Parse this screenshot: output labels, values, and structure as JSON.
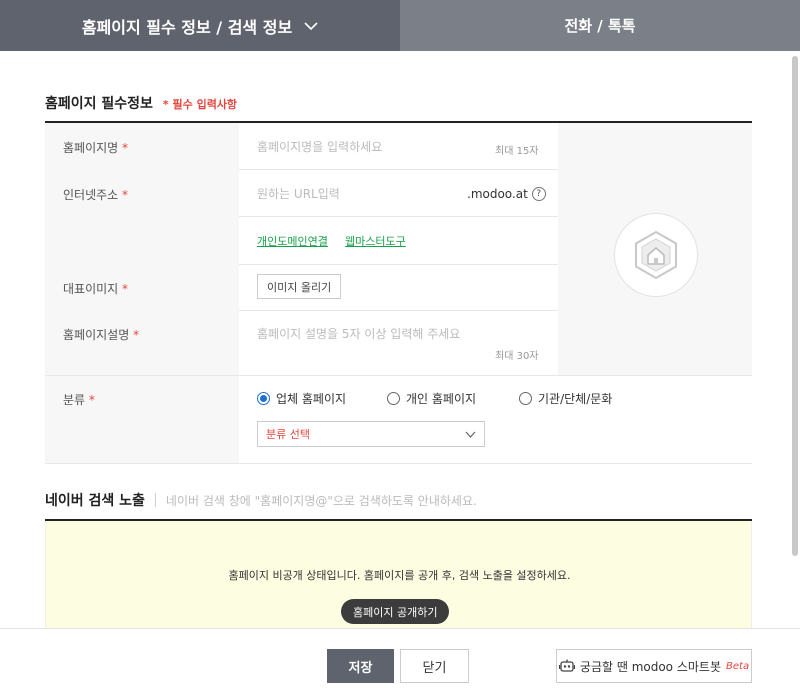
{
  "tabs": {
    "left_label": "홈페이지 필수 정보 / 검색 정보",
    "right_label": "전화 / 톡톡"
  },
  "section": {
    "title": "홈페이지 필수정보",
    "required_note": "* 필수 입력사항"
  },
  "fields": {
    "name": {
      "label": "홈페이지명",
      "star": "*",
      "placeholder": "홈페이지명을 입력하세요",
      "max": "최대 15자"
    },
    "url": {
      "label": "인터넷주소",
      "star": "*",
      "placeholder": "원하는 URL입력",
      "domain": ".modoo.at",
      "help": "?",
      "link1": "개인도메인연결",
      "link2": "웹마스터도구"
    },
    "image": {
      "label": "대표이미지",
      "star": "*",
      "button": "이미지 올리기"
    },
    "desc": {
      "label": "홈페이지설명",
      "star": "*",
      "placeholder": "홈페이지 설명을 5자 이상 입력해 주세요",
      "max": "최대 30자"
    },
    "category": {
      "label": "분류",
      "star": "*",
      "options": [
        "업체 홈페이지",
        "개인 홈페이지",
        "기관/단체/문화"
      ],
      "selected_index": 0,
      "select_value": "분류 선택"
    }
  },
  "naver": {
    "title": "네이버 검색 노출",
    "desc": "네이버 검색 창에 \"홈페이지명@\"으로 검색하도록 안내하세요.",
    "notice": "홈페이지 비공개 상태입니다. 홈페이지를 공개 후, 검색 노출을 설정하세요.",
    "public_button": "홈페이지 공개하기"
  },
  "footer": {
    "save": "저장",
    "close": "닫기",
    "bot_label": "궁금할 땐 modoo 스마트봇",
    "bot_beta": "Beta"
  },
  "colors": {
    "tab_active": "#5f636d",
    "tab_inactive": "#7b7f88",
    "required_red": "#e4473f",
    "link_green": "#1aa04a",
    "radio_blue": "#1f6fd0",
    "notice_bg": "#fdfde2"
  }
}
